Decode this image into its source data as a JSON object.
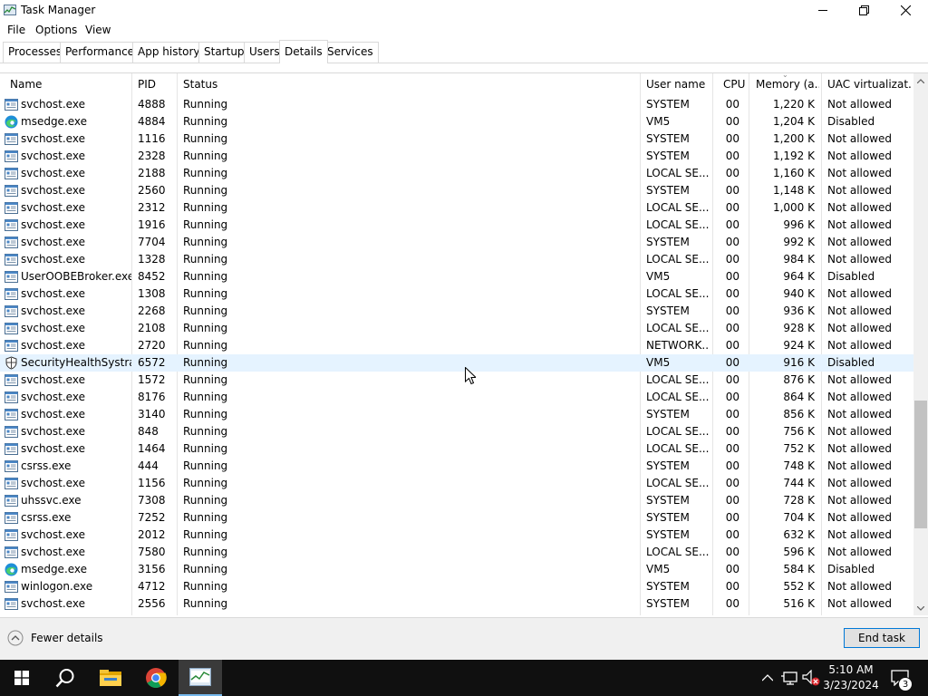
{
  "window": {
    "title": "Task Manager"
  },
  "menu": [
    "File",
    "Options",
    "View"
  ],
  "tabs": [
    {
      "label": "Processes",
      "active": false
    },
    {
      "label": "Performance",
      "active": false
    },
    {
      "label": "App history",
      "active": false
    },
    {
      "label": "Startup",
      "active": false
    },
    {
      "label": "Users",
      "active": false
    },
    {
      "label": "Details",
      "active": true
    },
    {
      "label": "Services",
      "active": false
    }
  ],
  "columns": {
    "name": "Name",
    "pid": "PID",
    "status": "Status",
    "user": "User name",
    "cpu": "CPU",
    "memory": "Memory (a...",
    "uac": "UAC virtualizat..."
  },
  "rows": [
    {
      "name": "svchost.exe",
      "pid": "4888",
      "status": "Running",
      "user": "SYSTEM",
      "cpu": "00",
      "memory": "1,220 K",
      "uac": "Not allowed",
      "icon": "service-host-icon"
    },
    {
      "name": "msedge.exe",
      "pid": "4884",
      "status": "Running",
      "user": "VM5",
      "cpu": "00",
      "memory": "1,204 K",
      "uac": "Disabled",
      "icon": "edge-icon"
    },
    {
      "name": "svchost.exe",
      "pid": "1116",
      "status": "Running",
      "user": "SYSTEM",
      "cpu": "00",
      "memory": "1,200 K",
      "uac": "Not allowed",
      "icon": "service-host-icon"
    },
    {
      "name": "svchost.exe",
      "pid": "2328",
      "status": "Running",
      "user": "SYSTEM",
      "cpu": "00",
      "memory": "1,192 K",
      "uac": "Not allowed",
      "icon": "service-host-icon"
    },
    {
      "name": "svchost.exe",
      "pid": "2188",
      "status": "Running",
      "user": "LOCAL SE...",
      "cpu": "00",
      "memory": "1,160 K",
      "uac": "Not allowed",
      "icon": "service-host-icon"
    },
    {
      "name": "svchost.exe",
      "pid": "2560",
      "status": "Running",
      "user": "SYSTEM",
      "cpu": "00",
      "memory": "1,148 K",
      "uac": "Not allowed",
      "icon": "service-host-icon"
    },
    {
      "name": "svchost.exe",
      "pid": "2312",
      "status": "Running",
      "user": "LOCAL SE...",
      "cpu": "00",
      "memory": "1,000 K",
      "uac": "Not allowed",
      "icon": "service-host-icon"
    },
    {
      "name": "svchost.exe",
      "pid": "1916",
      "status": "Running",
      "user": "LOCAL SE...",
      "cpu": "00",
      "memory": "996 K",
      "uac": "Not allowed",
      "icon": "service-host-icon"
    },
    {
      "name": "svchost.exe",
      "pid": "7704",
      "status": "Running",
      "user": "SYSTEM",
      "cpu": "00",
      "memory": "992 K",
      "uac": "Not allowed",
      "icon": "service-host-icon"
    },
    {
      "name": "svchost.exe",
      "pid": "1328",
      "status": "Running",
      "user": "LOCAL SE...",
      "cpu": "00",
      "memory": "984 K",
      "uac": "Not allowed",
      "icon": "service-host-icon"
    },
    {
      "name": "UserOOBEBroker.exe",
      "pid": "8452",
      "status": "Running",
      "user": "VM5",
      "cpu": "00",
      "memory": "964 K",
      "uac": "Disabled",
      "icon": "service-host-icon"
    },
    {
      "name": "svchost.exe",
      "pid": "1308",
      "status": "Running",
      "user": "LOCAL SE...",
      "cpu": "00",
      "memory": "940 K",
      "uac": "Not allowed",
      "icon": "service-host-icon"
    },
    {
      "name": "svchost.exe",
      "pid": "2268",
      "status": "Running",
      "user": "SYSTEM",
      "cpu": "00",
      "memory": "936 K",
      "uac": "Not allowed",
      "icon": "service-host-icon"
    },
    {
      "name": "svchost.exe",
      "pid": "2108",
      "status": "Running",
      "user": "LOCAL SE...",
      "cpu": "00",
      "memory": "928 K",
      "uac": "Not allowed",
      "icon": "service-host-icon"
    },
    {
      "name": "svchost.exe",
      "pid": "2720",
      "status": "Running",
      "user": "NETWORK...",
      "cpu": "00",
      "memory": "924 K",
      "uac": "Not allowed",
      "icon": "service-host-icon"
    },
    {
      "name": "SecurityHealthSystra...",
      "pid": "6572",
      "status": "Running",
      "user": "VM5",
      "cpu": "00",
      "memory": "916 K",
      "uac": "Disabled",
      "icon": "shield-icon",
      "highlighted": true
    },
    {
      "name": "svchost.exe",
      "pid": "1572",
      "status": "Running",
      "user": "LOCAL SE...",
      "cpu": "00",
      "memory": "876 K",
      "uac": "Not allowed",
      "icon": "service-host-icon"
    },
    {
      "name": "svchost.exe",
      "pid": "8176",
      "status": "Running",
      "user": "LOCAL SE...",
      "cpu": "00",
      "memory": "864 K",
      "uac": "Not allowed",
      "icon": "service-host-icon"
    },
    {
      "name": "svchost.exe",
      "pid": "3140",
      "status": "Running",
      "user": "SYSTEM",
      "cpu": "00",
      "memory": "856 K",
      "uac": "Not allowed",
      "icon": "service-host-icon"
    },
    {
      "name": "svchost.exe",
      "pid": "848",
      "status": "Running",
      "user": "LOCAL SE...",
      "cpu": "00",
      "memory": "756 K",
      "uac": "Not allowed",
      "icon": "service-host-icon"
    },
    {
      "name": "svchost.exe",
      "pid": "1464",
      "status": "Running",
      "user": "LOCAL SE...",
      "cpu": "00",
      "memory": "752 K",
      "uac": "Not allowed",
      "icon": "service-host-icon"
    },
    {
      "name": "csrss.exe",
      "pid": "444",
      "status": "Running",
      "user": "SYSTEM",
      "cpu": "00",
      "memory": "748 K",
      "uac": "Not allowed",
      "icon": "service-host-icon"
    },
    {
      "name": "svchost.exe",
      "pid": "1156",
      "status": "Running",
      "user": "LOCAL SE...",
      "cpu": "00",
      "memory": "744 K",
      "uac": "Not allowed",
      "icon": "service-host-icon"
    },
    {
      "name": "uhssvc.exe",
      "pid": "7308",
      "status": "Running",
      "user": "SYSTEM",
      "cpu": "00",
      "memory": "728 K",
      "uac": "Not allowed",
      "icon": "service-host-icon"
    },
    {
      "name": "csrss.exe",
      "pid": "7252",
      "status": "Running",
      "user": "SYSTEM",
      "cpu": "00",
      "memory": "704 K",
      "uac": "Not allowed",
      "icon": "service-host-icon"
    },
    {
      "name": "svchost.exe",
      "pid": "2012",
      "status": "Running",
      "user": "SYSTEM",
      "cpu": "00",
      "memory": "632 K",
      "uac": "Not allowed",
      "icon": "service-host-icon"
    },
    {
      "name": "svchost.exe",
      "pid": "7580",
      "status": "Running",
      "user": "LOCAL SE...",
      "cpu": "00",
      "memory": "596 K",
      "uac": "Not allowed",
      "icon": "service-host-icon"
    },
    {
      "name": "msedge.exe",
      "pid": "3156",
      "status": "Running",
      "user": "VM5",
      "cpu": "00",
      "memory": "584 K",
      "uac": "Disabled",
      "icon": "edge-icon"
    },
    {
      "name": "winlogon.exe",
      "pid": "4712",
      "status": "Running",
      "user": "SYSTEM",
      "cpu": "00",
      "memory": "552 K",
      "uac": "Not allowed",
      "icon": "service-host-icon"
    },
    {
      "name": "svchost.exe",
      "pid": "2556",
      "status": "Running",
      "user": "SYSTEM",
      "cpu": "00",
      "memory": "516 K",
      "uac": "Not allowed",
      "icon": "service-host-icon"
    }
  ],
  "footer": {
    "fewer_details": "Fewer details",
    "end_task": "End task"
  },
  "taskbar": {
    "time": "5:10 AM",
    "date": "3/23/2024",
    "notification_count": "3"
  },
  "colors": {
    "highlight_row": "#e5f3ff",
    "taskbar": "#101010",
    "accent": "#0078d7"
  }
}
